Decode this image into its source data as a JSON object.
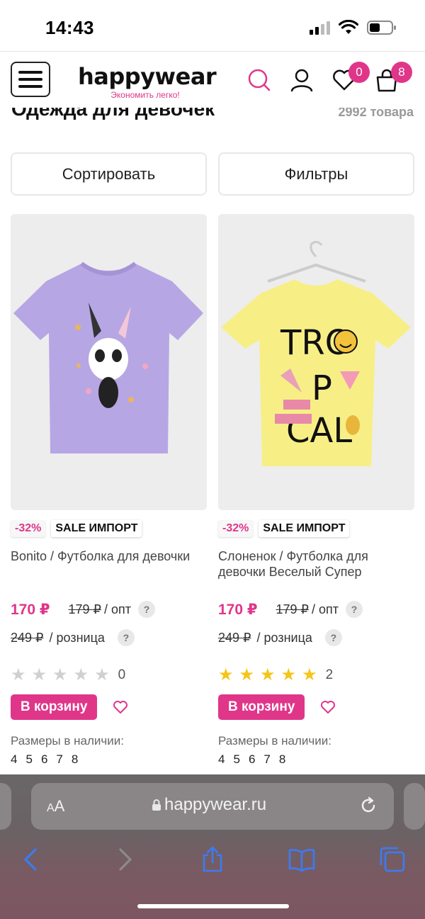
{
  "status_bar": {
    "time": "14:43"
  },
  "header": {
    "logo": "happywear",
    "tagline": "Экономить легко!",
    "favorites_count": "0",
    "cart_count": "8"
  },
  "page": {
    "title": "Одежда для девочек",
    "item_count": "2992 товара",
    "sort_label": "Сортировать",
    "filter_label": "Фильтры"
  },
  "products": [
    {
      "discount": "-32%",
      "tag": "SALE ИМПОРТ",
      "name": "Bonito / Футболка для девочки",
      "price": "170 ₽",
      "old_price": "179 ₽",
      "opt_label": "/ опт",
      "retail_price": "249 ₽",
      "retail_label": "/ розница",
      "rating": 0,
      "reviews": "0",
      "cart_label": "В корзину",
      "sizes_label": "Размеры в наличии:",
      "sizes": [
        "4",
        "5",
        "6",
        "7",
        "8"
      ],
      "image_color": "#b7a6e4"
    },
    {
      "discount": "-32%",
      "tag": "SALE ИМПОРТ",
      "name": "Слоненок / Футболка для девочки Веселый Супер",
      "price": "170 ₽",
      "old_price": "179 ₽",
      "opt_label": "/ опт",
      "retail_price": "249 ₽",
      "retail_label": "/ розница",
      "rating": 5,
      "reviews": "2",
      "cart_label": "В корзину",
      "sizes_label": "Размеры в наличии:",
      "sizes": [
        "4",
        "5",
        "6",
        "7",
        "8"
      ],
      "image_color": "#f7ef86"
    }
  ],
  "safari": {
    "aa_label": "AA",
    "url": "happywear.ru"
  },
  "colors": {
    "accent": "#e0368a",
    "star": "#f5c518"
  }
}
